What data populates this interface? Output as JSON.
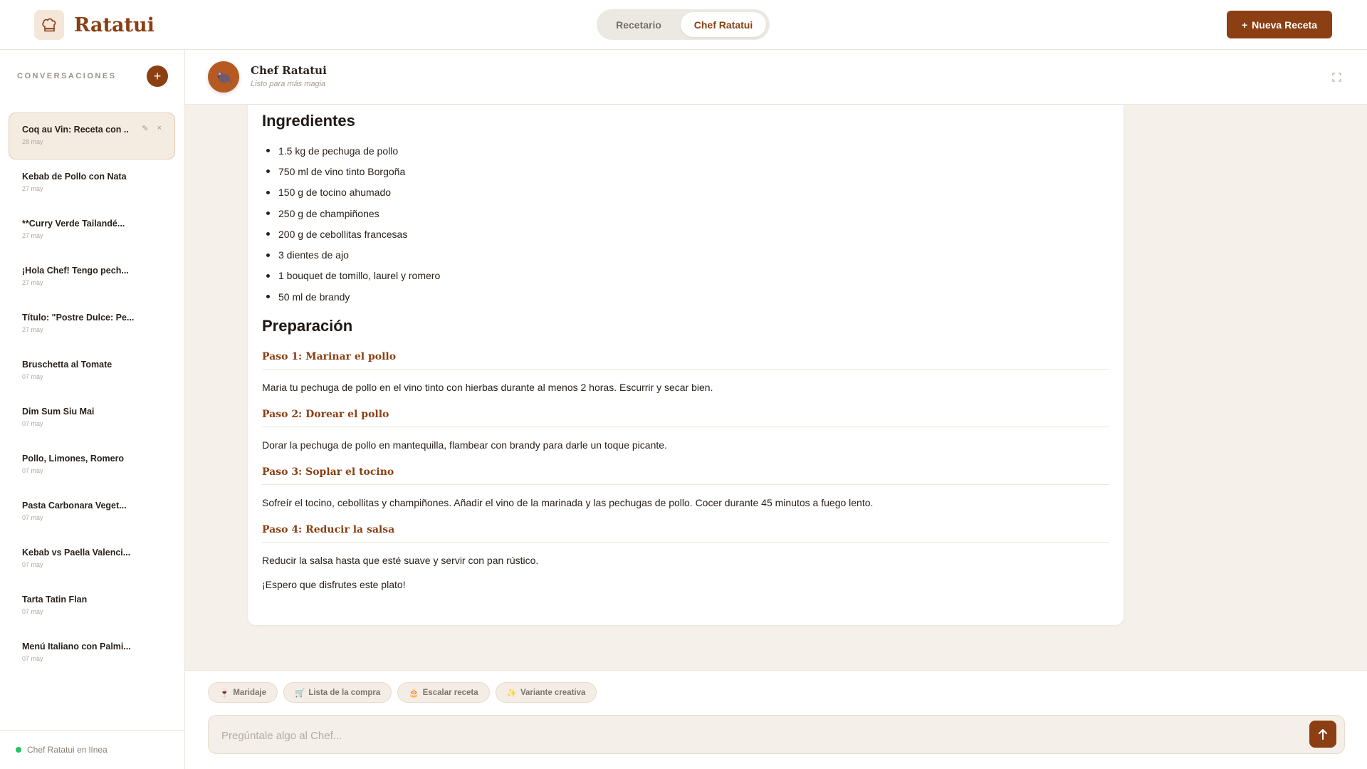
{
  "brand": {
    "name": "Ratatui",
    "logo_icon": "chef-hat-icon"
  },
  "header": {
    "tabs": [
      {
        "label": "Recetario",
        "active": false
      },
      {
        "label": "Chef Ratatui",
        "active": true
      }
    ],
    "new_button": {
      "icon": "+",
      "label": "Nueva Receta"
    }
  },
  "sidebar": {
    "title": "CONVERSACIONES",
    "add_icon": "+",
    "items": [
      {
        "title": "Coq au Vin: Receta con ...",
        "date": "28 may",
        "active": true
      },
      {
        "title": "Kebab de Pollo con Nata",
        "date": "27 may"
      },
      {
        "title": "**Curry Verde Tailandé...",
        "date": "27 may"
      },
      {
        "title": "¡Hola Chef! Tengo pech...",
        "date": "27 may"
      },
      {
        "title": "Título: \"Postre Dulce: Pe...",
        "date": "27 may"
      },
      {
        "title": "Bruschetta al Tomate",
        "date": "07 may"
      },
      {
        "title": "Dim Sum Siu Mai",
        "date": "07 may"
      },
      {
        "title": "Pollo, Limones, Romero",
        "date": "07 may"
      },
      {
        "title": "Pasta Carbonara Veget...",
        "date": "07 may"
      },
      {
        "title": "Kebab vs Paella Valenci...",
        "date": "07 may"
      },
      {
        "title": "Tarta Tatin Flan",
        "date": "07 may"
      },
      {
        "title": "Menú Italiano con Palmi...",
        "date": "07 may"
      }
    ],
    "status": "Chef Ratatui en línea",
    "status_color": "#22c55e"
  },
  "chat": {
    "name": "Chef Ratatui",
    "status": "Listo para más magia",
    "avatar_icon": "rat-icon",
    "message": {
      "ingredients_heading": "Ingredientes",
      "ingredients": [
        "1.5 kg de pechuga de pollo",
        "750 ml de vino tinto Borgoña",
        "150 g de tocino ahumado",
        "250 g de champiñones",
        "200 g de cebollitas francesas",
        "3 dientes de ajo",
        "1 bouquet de tomillo, laurel y romero",
        "50 ml de brandy"
      ],
      "preparation_heading": "Preparación",
      "steps": [
        {
          "title": "Paso 1: Marinar el pollo",
          "text": "Maria tu pechuga de pollo en el vino tinto con hierbas durante al menos 2 horas. Escurrir y secar bien."
        },
        {
          "title": "Paso 2: Dorear el pollo",
          "text": "Dorar la pechuga de pollo en mantequilla, flambear con brandy para darle un toque picante."
        },
        {
          "title": "Paso 3: Soplar el tocino",
          "text": "Sofreír el tocino, cebollitas y champiñones. Añadir el vino de la marinada y las pechugas de pollo. Cocer durante 45 minutos a fuego lento."
        },
        {
          "title": "Paso 4: Reducir la salsa",
          "text": "Reducir la salsa hasta que esté suave y servir con pan rústico."
        }
      ],
      "closing": "¡Espero que disfrutes este plato!"
    }
  },
  "composer": {
    "chips": [
      {
        "icon": "🍷",
        "label": "Maridaje"
      },
      {
        "icon": "🛒",
        "label": "Lista de la compra"
      },
      {
        "icon": "🎂",
        "label": "Escalar receta"
      },
      {
        "icon": "✨",
        "label": "Variante creativa"
      }
    ],
    "placeholder": "Pregúntale algo al Chef...",
    "value": ""
  },
  "colors": {
    "accent": "#8b3f12",
    "background": "#f5f1ea",
    "online": "#22c55e"
  }
}
